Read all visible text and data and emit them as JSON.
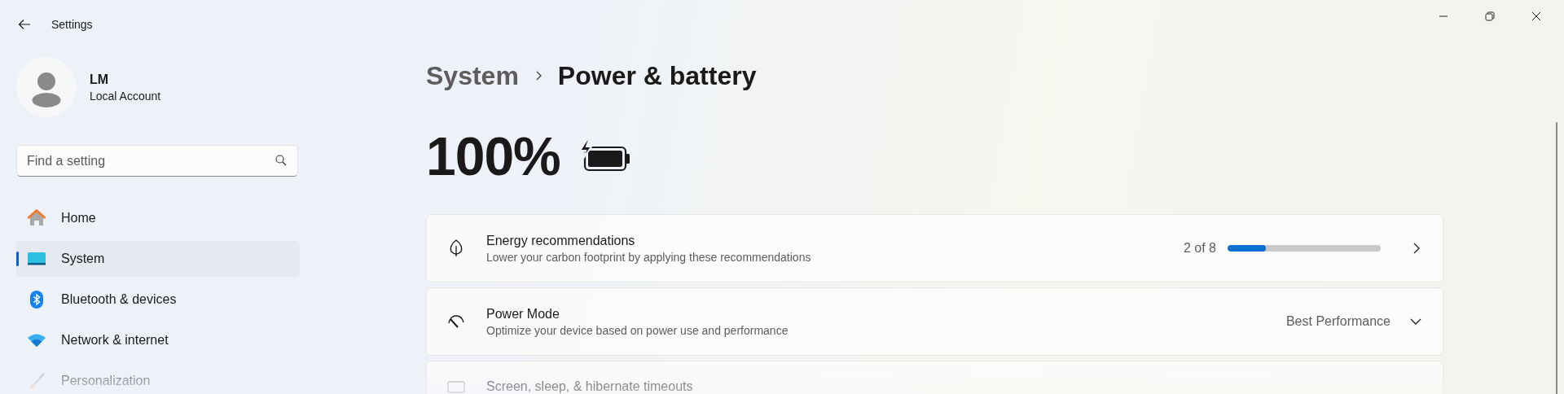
{
  "window": {
    "title": "Settings"
  },
  "account": {
    "name": "LM",
    "type": "Local Account"
  },
  "search": {
    "placeholder": "Find a setting"
  },
  "nav": [
    {
      "label": "Home",
      "selected": false
    },
    {
      "label": "System",
      "selected": true
    },
    {
      "label": "Bluetooth & devices",
      "selected": false
    },
    {
      "label": "Network & internet",
      "selected": false
    },
    {
      "label": "Personalization",
      "selected": false
    }
  ],
  "breadcrumb": {
    "parent": "System",
    "current": "Power & battery"
  },
  "battery": {
    "percent": "100%",
    "charging": true
  },
  "cards": [
    {
      "kind": "progress",
      "title": "Energy recommendations",
      "subtitle": "Lower your carbon footprint by applying these recommendations",
      "reading": "2 of 8",
      "level": 0.25
    },
    {
      "kind": "dropdown",
      "title": "Power Mode",
      "subtitle": "Optimize your device based on power use and performance",
      "value": "Best Performance"
    },
    {
      "kind": "plain",
      "title": "Screen, sleep, & hibernate timeouts"
    }
  ]
}
